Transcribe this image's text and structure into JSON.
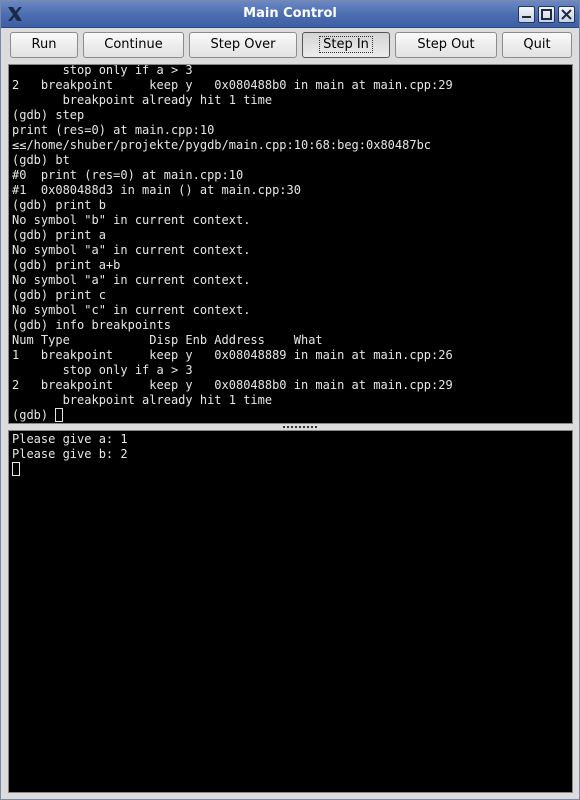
{
  "window": {
    "title": "Main Control"
  },
  "toolbar": {
    "buttons": [
      {
        "label": "Run"
      },
      {
        "label": "Continue"
      },
      {
        "label": "Step Over"
      },
      {
        "label": "Step In"
      },
      {
        "label": "Step Out"
      },
      {
        "label": "Quit"
      }
    ],
    "active_button": "Step In"
  },
  "gdb_console": {
    "lines": [
      "       stop only if a > 3",
      "2   breakpoint     keep y   0x080488b0 in main at main.cpp:29",
      "       breakpoint already hit 1 time",
      "(gdb) step",
      "print (res=0) at main.cpp:10",
      "≤≤/home/shuber/projekte/pygdb/main.cpp:10:68:beg:0x80487bc",
      "(gdb) bt",
      "#0  print (res=0) at main.cpp:10",
      "#1  0x080488d3 in main () at main.cpp:30",
      "(gdb) print b",
      "No symbol \"b\" in current context.",
      "(gdb) print a",
      "No symbol \"a\" in current context.",
      "(gdb) print a+b",
      "No symbol \"a\" in current context.",
      "(gdb) print c",
      "No symbol \"c\" in current context.",
      "(gdb) info breakpoints",
      "Num Type           Disp Enb Address    What",
      "1   breakpoint     keep y   0x08048889 in main at main.cpp:26",
      "       stop only if a > 3",
      "2   breakpoint     keep y   0x080488b0 in main at main.cpp:29",
      "       breakpoint already hit 1 time"
    ],
    "prompt": "(gdb) "
  },
  "program_output": {
    "lines": [
      "Please give a: 1",
      "Please give b: 2"
    ]
  },
  "colors": {
    "titlebar": "#4a6cb0",
    "terminal_bg": "#000000",
    "terminal_fg": "#e6e6e6"
  }
}
